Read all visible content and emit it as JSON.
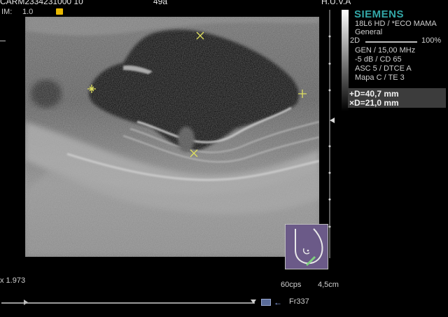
{
  "header": {
    "patient_id": "CARM2334231000 10",
    "age": "49a",
    "hospital": "H.U.V.A",
    "im_label": "IM:",
    "im_value": "1.0"
  },
  "brand": "SIEMENS",
  "settings": {
    "transducer": "18L6 HD / *ECO MAMA",
    "preset": "General",
    "mode": "2D",
    "power": "100%",
    "frequency": "GEN / 15,00 MHz",
    "gain": "-5 dB / CD 65",
    "asc": "ASC 5 / DTCE A",
    "map": "Mapa C / TE 3"
  },
  "measurements": [
    {
      "symbol": "+",
      "text": "D=40,7 mm"
    },
    {
      "symbol": "×",
      "text": "D=21,0 mm"
    }
  ],
  "footer": {
    "zoom": "x 1.973",
    "frame_rate": "60cps",
    "depth": "4,5cm",
    "frame": "Fr337"
  },
  "colors": {
    "brand": "#33a8a8",
    "caliper": "#e0e060",
    "bodymark": "#6b5a88",
    "probe": "#7fd07f"
  }
}
